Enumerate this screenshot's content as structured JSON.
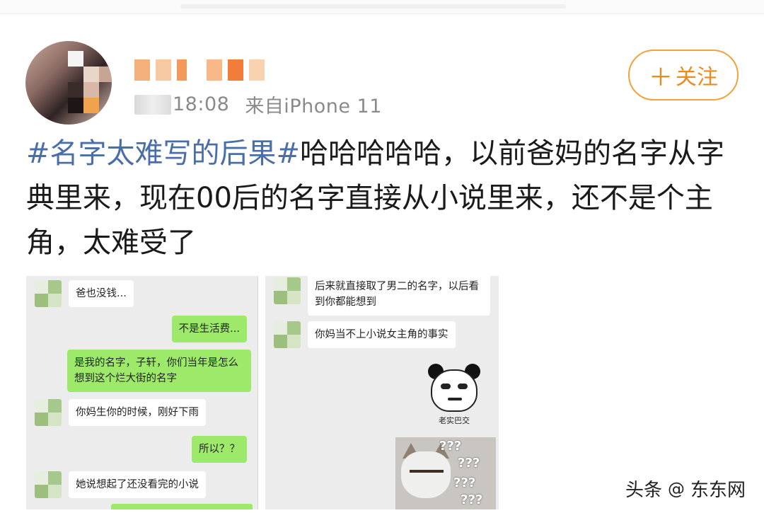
{
  "post": {
    "time": "18:08",
    "source": "来自iPhone 11",
    "follow_label": "关注",
    "follow_icon": "plus-icon",
    "hashtag": "#名字太难写的后果#",
    "body_text": "哈哈哈哈哈，以前爸妈的名字从字典里来，现在00后的名字直接从小说里来，还不是个主角，太难受了"
  },
  "colors": {
    "hashtag": "#4a6fa8",
    "follow_accent": "#ee8a1a",
    "meta_text": "#8a8a8a",
    "bubble_green": "#9dea6a"
  },
  "chat_left": {
    "m1": "爸也没钱...",
    "m2": "不是生活费...",
    "m3": "是我的名字，子轩，你们当年是怎么想到这个烂大街的名字",
    "m4": "你妈生你的时候，刚好下雨",
    "m5": "所以？？",
    "m6": "她说想起了还没看完的小说"
  },
  "chat_right": {
    "m1": "后来就直接取了男二的名字，以后看到你都能想到",
    "m2": "你妈当不上小说女主角的事实",
    "sticker1_caption": "老实巴交",
    "sticker2_text": "???"
  },
  "watermark": {
    "platform": "头条",
    "at": "@",
    "account": "东东网"
  }
}
